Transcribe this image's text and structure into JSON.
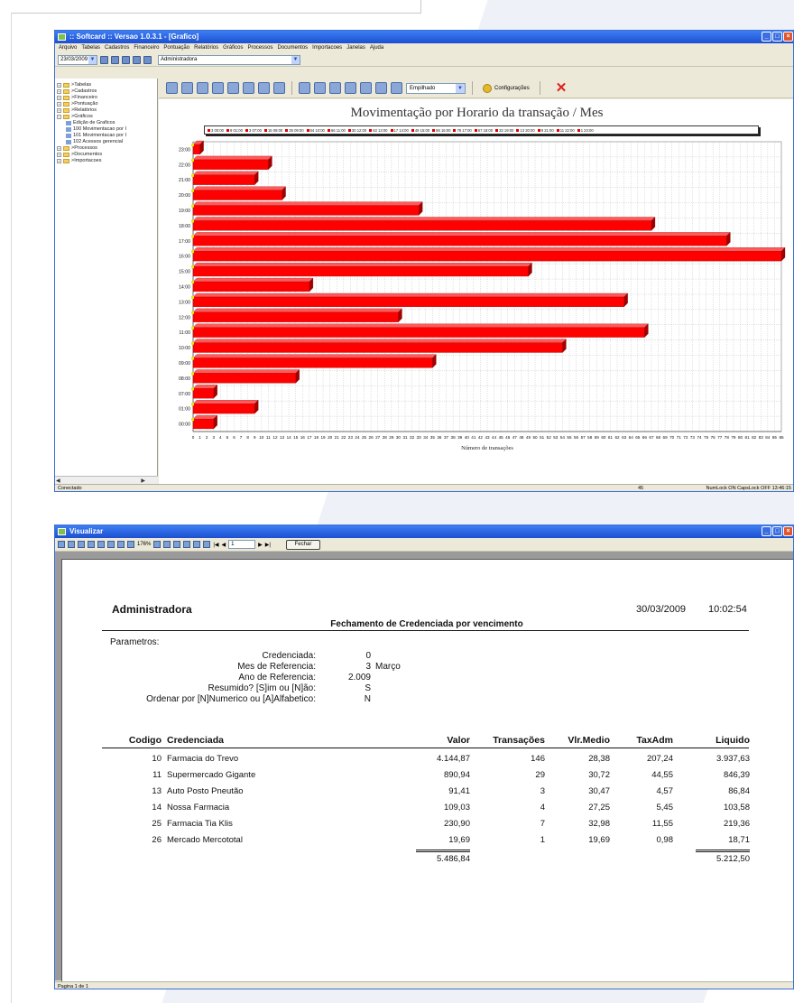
{
  "app_window": {
    "title": ":: Softcard :: Versao 1.0.3.1 - [Grafico]",
    "menu": [
      "Arquivo",
      "Tabelas",
      "Cadastros",
      "Financeiro",
      "Pontuação",
      "Relatórios",
      "Gráficos",
      "Processos",
      "Documentos",
      "Importacoes",
      "Janelas",
      "Ajuda"
    ],
    "date_combo": "23/03/2009",
    "company_combo": "Administradora",
    "tree": [
      {
        "label": ">Tabelas",
        "level": 1
      },
      {
        "label": ">Cadastros",
        "level": 1
      },
      {
        "label": ">Financeiro",
        "level": 1
      },
      {
        "label": ">Pontuação",
        "level": 1
      },
      {
        "label": ">Relatórios",
        "level": 1
      },
      {
        "label": ">Gráficos",
        "level": 1
      },
      {
        "label": "Edição de Graficos",
        "level": 2
      },
      {
        "label": "100  Movimentacao por I",
        "level": 2
      },
      {
        "label": "101  Movimentacao por I",
        "level": 2
      },
      {
        "label": "102  Acessos gerencial",
        "level": 2
      },
      {
        "label": ">Processos",
        "level": 1
      },
      {
        "label": ">Documentos",
        "level": 1
      },
      {
        "label": ">Importacoes",
        "level": 1
      }
    ],
    "chart_mode": "Empilhado",
    "config_label": "Configurações",
    "status": {
      "left": "Conectado",
      "center": "45",
      "right": "NumLock ON   CapsLock OFF   13:46:15"
    }
  },
  "chart_data": {
    "type": "bar",
    "orientation": "horizontal",
    "title": "Movimentação por Horario da transação / Mes",
    "xlabel": "Número de transações",
    "ylabel": "",
    "xlim": [
      0,
      86
    ],
    "xticks": [
      0,
      1,
      2,
      3,
      4,
      5,
      6,
      7,
      8,
      9,
      10,
      11,
      12,
      13,
      14,
      15,
      16,
      17,
      18,
      19,
      20,
      21,
      22,
      23,
      24,
      25,
      26,
      27,
      28,
      29,
      30,
      31,
      32,
      33,
      34,
      35,
      36,
      37,
      38,
      39,
      40,
      41,
      42,
      43,
      44,
      45,
      46,
      47,
      48,
      49,
      50,
      51,
      52,
      53,
      54,
      55,
      56,
      57,
      58,
      59,
      60,
      61,
      62,
      63,
      64,
      65,
      66,
      67,
      68,
      69,
      70,
      71,
      72,
      73,
      74,
      75,
      76,
      77,
      78,
      79,
      80,
      81,
      82,
      83,
      84,
      85,
      86
    ],
    "grid": true,
    "legend_position": "top",
    "legend": [
      "3 00:00",
      "9 01:00",
      "3 07:00",
      "15 08:00",
      "35 09:00",
      "54 10:00",
      "66 11:00",
      "30 12:00",
      "63 13:00",
      "17 14:00",
      "49 15:00",
      "86 16:00",
      "78 17:00",
      "67 18:00",
      "33 19:00",
      "13 20:00",
      "9 21:00",
      "11 22:00",
      "1 23:00"
    ],
    "categories": [
      "23:00",
      "22:00",
      "21:00",
      "20:00",
      "19:00",
      "18:00",
      "17:00",
      "16:00",
      "15:00",
      "14:00",
      "13:00",
      "12:00",
      "11:00",
      "10:00",
      "09:00",
      "08:00",
      "07:00",
      "01:00",
      "00:00"
    ],
    "values": [
      1,
      11,
      9,
      13,
      33,
      67,
      78,
      86,
      49,
      17,
      63,
      30,
      66,
      54,
      35,
      15,
      3,
      9,
      3
    ],
    "color": "#ff0000"
  },
  "report_window": {
    "title": "Visualizar",
    "zoom": "176%",
    "page_input": "1",
    "close_button": "Fechar",
    "status": "Pagina 1 de 1"
  },
  "report": {
    "company": "Administradora",
    "date": "30/03/2009",
    "time": "10:02:54",
    "title": "Fechamento de Credenciada por vencimento",
    "params_label": "Parametros:",
    "params": [
      {
        "key": "Credenciada:",
        "value": "0",
        "extra": ""
      },
      {
        "key": "Mes de Referencia:",
        "value": "3",
        "extra": "Março"
      },
      {
        "key": "Ano de Referencia:",
        "value": "2.009",
        "extra": ""
      },
      {
        "key": "Resumido? [S]im ou [N]ão:",
        "value": "S",
        "extra": ""
      },
      {
        "key": "Ordenar por [N]Numerico ou [A]Alfabetico:",
        "value": "N",
        "extra": ""
      }
    ],
    "columns": [
      "Codigo",
      "Credenciada",
      "Valor",
      "Transações",
      "Vlr.Medio",
      "TaxAdm",
      "Liquido"
    ],
    "rows": [
      [
        "10",
        "Farmacia do Trevo",
        "4.144,87",
        "146",
        "28,38",
        "207,24",
        "3.937,63"
      ],
      [
        "11",
        "Supermercado Gigante",
        "890,94",
        "29",
        "30,72",
        "44,55",
        "846,39"
      ],
      [
        "13",
        "Auto Posto Pneutão",
        "91,41",
        "3",
        "30,47",
        "4,57",
        "86,84"
      ],
      [
        "14",
        "Nossa Farmacia",
        "109,03",
        "4",
        "27,25",
        "5,45",
        "103,58"
      ],
      [
        "25",
        "Farmacia Tia Klis",
        "230,90",
        "7",
        "32,98",
        "11,55",
        "219,36"
      ],
      [
        "26",
        "Mercado Mercototal",
        "19,69",
        "1",
        "19,69",
        "0,98",
        "18,71"
      ]
    ],
    "totals": {
      "valor": "5.486,84",
      "liquido": "5.212,50"
    }
  }
}
